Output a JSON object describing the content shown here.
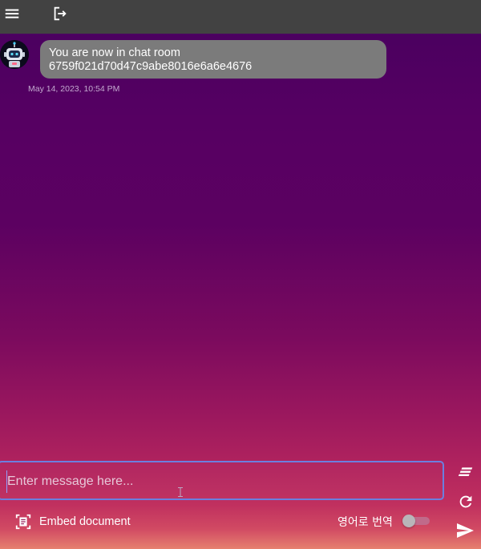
{
  "toolbar": {
    "menu_icon": "menu-icon",
    "logout_icon": "logout-icon"
  },
  "chat": {
    "messages": [
      {
        "sender_icon": "robot-avatar",
        "lines": [
          "You are now in chat room",
          "6759f021d70d47c9abe8016e6a6e4676"
        ],
        "timestamp": "May 14, 2023, 10:54 PM"
      }
    ]
  },
  "composer": {
    "input_value": "",
    "input_placeholder": "Enter message here...",
    "embed_label": "Embed document",
    "embed_icon": "document-scan-icon",
    "translate_label": "영어로 번역",
    "translate_enabled": false,
    "tools": [
      "summarize-icon",
      "refresh-icon",
      "send-icon"
    ]
  },
  "colors": {
    "topbar": "#424242",
    "bubble": "#7b7b7b",
    "input_border": "#6b7fe0",
    "gradient_top": "#3a0a63",
    "gradient_bottom": "#e6816f"
  }
}
